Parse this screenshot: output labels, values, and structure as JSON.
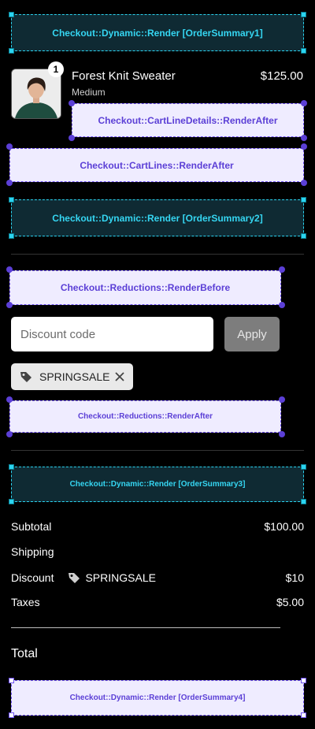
{
  "targets": {
    "order_summary_1": "Checkout::Dynamic::Render [OrderSummary1]",
    "cart_line_details_after": "Checkout::CartLineDetails::RenderAfter",
    "cart_lines_after": "Checkout::CartLines::RenderAfter",
    "order_summary_2": "Checkout::Dynamic::Render [OrderSummary2]",
    "reductions_before": "Checkout::Reductions::RenderBefore",
    "reductions_after": "Checkout::Reductions::RenderAfter",
    "order_summary_3": "Checkout::Dynamic::Render [OrderSummary3]",
    "order_summary_4": "Checkout::Dynamic::Render [OrderSummary4]"
  },
  "cart": {
    "items": [
      {
        "quantity": "1",
        "name": "Forest Knit Sweater",
        "variant": "Medium",
        "price": "$125.00"
      }
    ]
  },
  "discount": {
    "placeholder": "Discount code",
    "apply_label": "Apply",
    "applied_code": "SPRINGSALE"
  },
  "summary": {
    "subtotal_label": "Subtotal",
    "subtotal_value": "$100.00",
    "shipping_label": "Shipping",
    "discount_label": "Discount",
    "discount_code": "SPRINGSALE",
    "discount_value": "$10",
    "taxes_label": "Taxes",
    "taxes_value": "$5.00",
    "total_label": "Total"
  },
  "icons": {
    "tag": "tag-icon",
    "remove": "close-icon"
  },
  "colors": {
    "background": "#000000",
    "dynamic_target_border": "#2bd4f0",
    "static_target_border": "#6b4ef0",
    "static_target_text": "#5b3fd6"
  }
}
